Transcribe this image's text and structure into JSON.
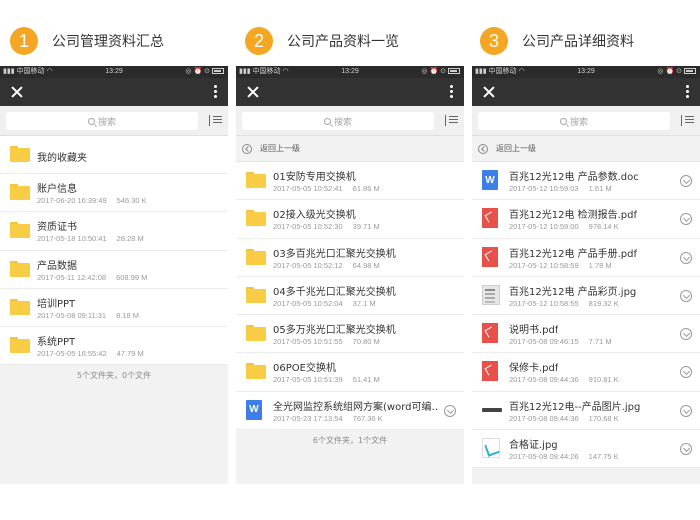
{
  "status": {
    "carrier": "中国移动",
    "time": "13:29"
  },
  "steps": [
    {
      "num": "1",
      "title": "公司管理资料汇总"
    },
    {
      "num": "2",
      "title": "公司产品资料一览"
    },
    {
      "num": "3",
      "title": "公司产品详细资料"
    }
  ],
  "search": {
    "placeholder": "搜索"
  },
  "back_label": "返回上一级",
  "screen1": {
    "favorites": "我的收藏夹",
    "items": [
      {
        "name": "账户信息",
        "date": "2017-06-20 16:39:49",
        "size": "546.30 K"
      },
      {
        "name": "资质证书",
        "date": "2017-05-18 10:50:41",
        "size": "28.28 M"
      },
      {
        "name": "产品数据",
        "date": "2017-05-11 12:42:08",
        "size": "608.99 M"
      },
      {
        "name": "培训PPT",
        "date": "2017-05-08 09:11:31",
        "size": "8.18 M"
      },
      {
        "name": "系统PPT",
        "date": "2017-05-05 16:55:42",
        "size": "47.79 M"
      }
    ],
    "footer": "5个文件夹，0个文件"
  },
  "screen2": {
    "items": [
      {
        "name": "01安防专用交换机",
        "date": "2017-05-05 10:52:41",
        "size": "61.86 M"
      },
      {
        "name": "02接入级光交换机",
        "date": "2017-05-05 10:52:30",
        "size": "39.71 M"
      },
      {
        "name": "03多百兆光口汇聚光交换机",
        "date": "2017-05-05 10:52:12",
        "size": "64.98 M"
      },
      {
        "name": "04多千兆光口汇聚光交换机",
        "date": "2017-05-05 10:52:04",
        "size": "37.1 M"
      },
      {
        "name": "05多万兆光口汇聚光交换机",
        "date": "2017-05-05 10:51:55",
        "size": "70.80 M"
      },
      {
        "name": "06POE交换机",
        "date": "2017-05-05 10:51:39",
        "size": "51.41 M"
      }
    ],
    "file": {
      "name": "全光网监控系统组网方案(word可编…",
      "date": "2017-05-23 17:13:54",
      "size": "767.36 K"
    },
    "footer": "6个文件夹，1个文件"
  },
  "screen3": {
    "items": [
      {
        "icon": "word",
        "name": "百兆12光12电 产品参数.doc",
        "date": "2017-05-12 10:59:03",
        "size": "1.61 M"
      },
      {
        "icon": "pdf",
        "name": "百兆12光12电 检测报告.pdf",
        "date": "2017-05-12 10:59:00",
        "size": "978.14 K"
      },
      {
        "icon": "pdf",
        "name": "百兆12光12电 产品手册.pdf",
        "date": "2017-05-12 10:58:59",
        "size": "1.78 M"
      },
      {
        "icon": "jpg",
        "name": "百兆12光12电 产品彩页.jpg",
        "date": "2017-05-12 10:58:55",
        "size": "819.32 K"
      },
      {
        "icon": "pdf",
        "name": "说明书.pdf",
        "date": "2017-05-08 09:46:15",
        "size": "7.71 M"
      },
      {
        "icon": "pdf",
        "name": "保修卡.pdf",
        "date": "2017-05-08 09:44:36",
        "size": "910.81 K"
      },
      {
        "icon": "switch",
        "name": "百兆12光12电--产品图片.jpg",
        "date": "2017-05-08 09:44:36",
        "size": "170.68 K"
      },
      {
        "icon": "cert",
        "name": "合格证.jpg",
        "date": "2017-05-08 09:44:26",
        "size": "147.75 K"
      }
    ]
  },
  "colors": {
    "accent": "#f5a623",
    "toolbar": "#333333",
    "folder": "#f8cd45",
    "word": "#3d7ee8",
    "pdf": "#e8504a"
  }
}
